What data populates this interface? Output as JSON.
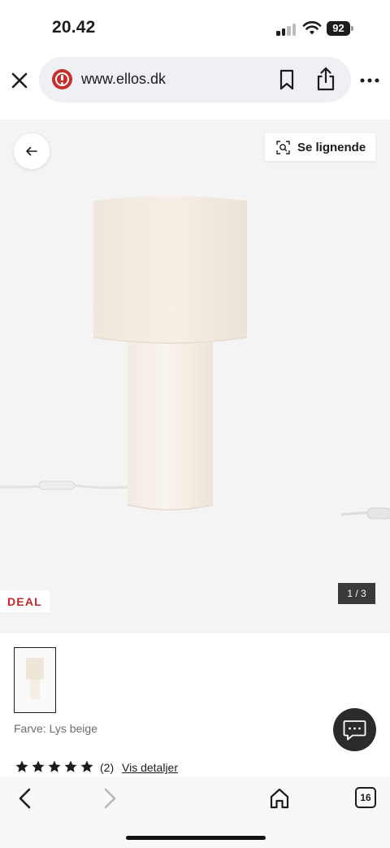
{
  "status_bar": {
    "time": "20.42",
    "battery": "92"
  },
  "browser": {
    "url": "www.ellos.dk",
    "tab_count": "16"
  },
  "product": {
    "similar_label": "Se lignende",
    "badge": "DEAL",
    "image_counter": "1 / 3",
    "color_text": "Farve: Lys beige",
    "rating": {
      "stars": 5,
      "count": "(2)",
      "details_link": "Vis detaljer"
    }
  },
  "colors": {
    "deal_red": "#c1272d",
    "warning_red": "#c4302b",
    "chat_button": "#2b2b2b",
    "image_bg": "#f4f4f4"
  }
}
